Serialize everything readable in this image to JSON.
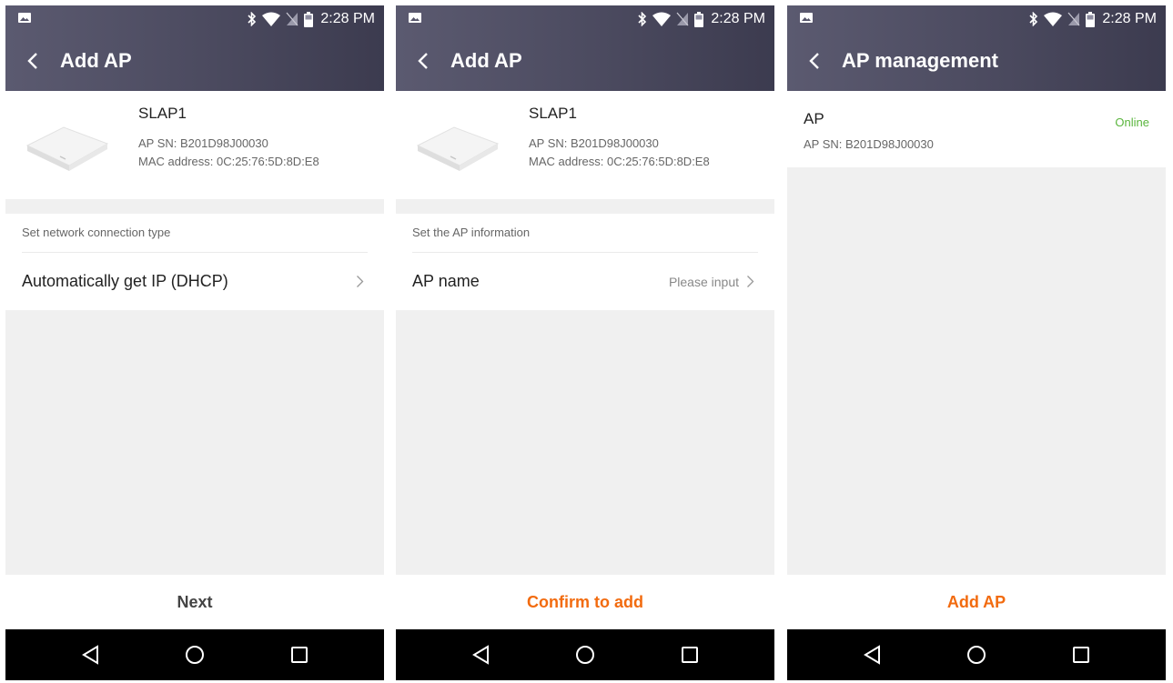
{
  "status_bar": {
    "time": "2:28 PM"
  },
  "screens": [
    {
      "title": "Add AP",
      "device": {
        "name": "SLAP1",
        "sn": "AP SN: B201D98J00030",
        "mac": "MAC address: 0C:25:76:5D:8D:E8"
      },
      "section": {
        "label": "Set network connection type",
        "row_label": "Automatically get IP (DHCP)"
      },
      "bottom_button": {
        "label": "Next",
        "color": "#444444"
      }
    },
    {
      "title": "Add AP",
      "device": {
        "name": "SLAP1",
        "sn": "AP SN: B201D98J00030",
        "mac": "MAC address: 0C:25:76:5D:8D:E8"
      },
      "section": {
        "label": "Set the AP information",
        "row_label": "AP name",
        "row_placeholder": "Please input"
      },
      "bottom_button": {
        "label": "Confirm to add",
        "color": "#f26b0f"
      }
    },
    {
      "title": "AP management",
      "ap_list": [
        {
          "name": "AP",
          "sn": "AP SN: B201D98J00030",
          "status": "Online"
        }
      ],
      "bottom_button": {
        "label": "Add AP",
        "color": "#f26b0f"
      }
    }
  ],
  "colors": {
    "header_start": "#5b5a70",
    "header_end": "#3c3b4f",
    "accent": "#f26b0f",
    "online": "#5ab53d"
  },
  "icons": [
    "image-icon",
    "bluetooth-icon",
    "wifi-icon",
    "no-sim-icon",
    "battery-icon",
    "back-arrow-icon",
    "chevron-right-icon",
    "nav-back-icon",
    "nav-home-icon",
    "nav-recents-icon",
    "access-point-icon"
  ]
}
